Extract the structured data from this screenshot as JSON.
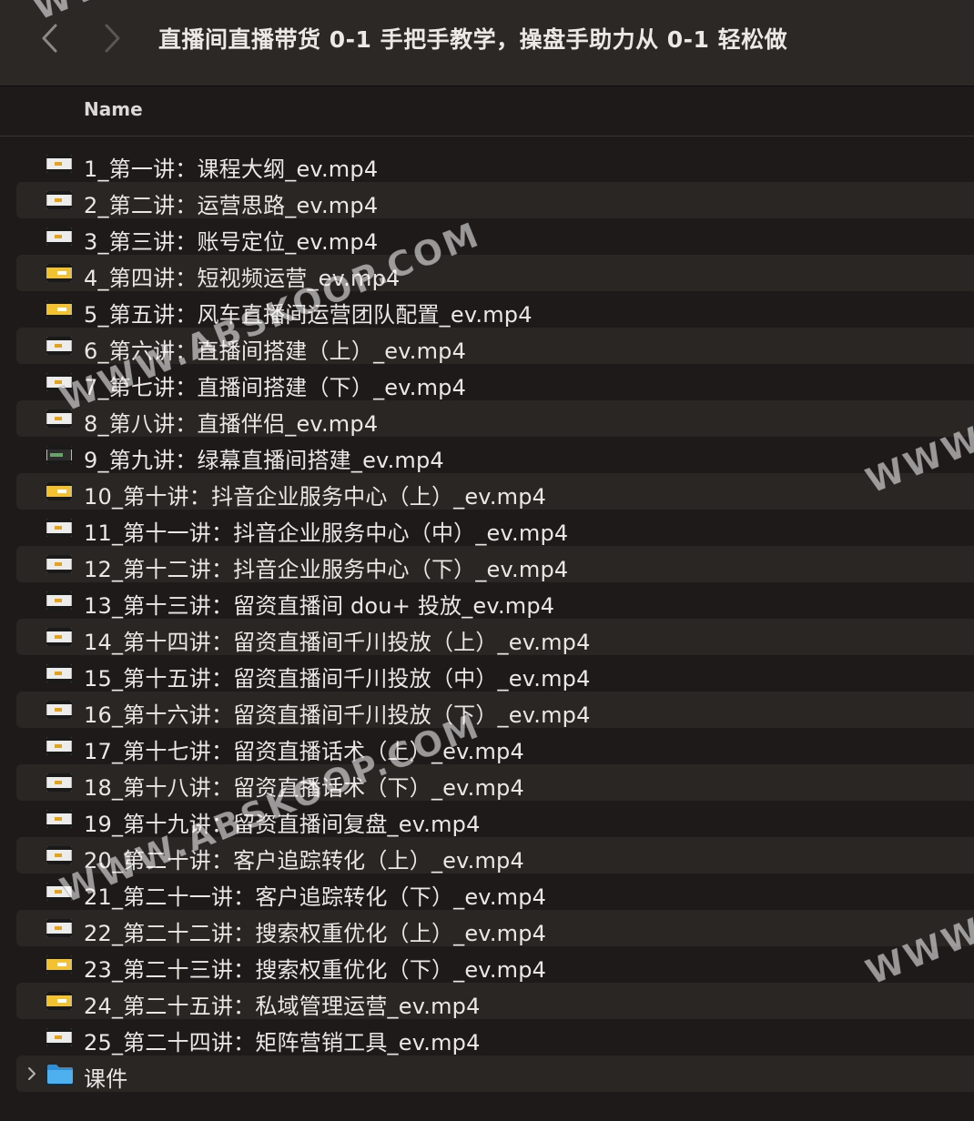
{
  "window": {
    "title": "直播间直播带货 0-1 手把手教学，操盘手助力从 0-1 轻松做"
  },
  "nav": {
    "back_icon": "chevron-left-icon",
    "forward_icon": "chevron-right-icon"
  },
  "columns": {
    "name": "Name"
  },
  "files": [
    {
      "name": "1_第一讲：课程大纲_ev.mp4",
      "thumb": "light"
    },
    {
      "name": "2_第二讲：运营思路_ev.mp4",
      "thumb": "light"
    },
    {
      "name": "3_第三讲：账号定位_ev.mp4",
      "thumb": "light"
    },
    {
      "name": "4_第四讲：短视频运营_ev.mp4",
      "thumb": "yellow"
    },
    {
      "name": "5_第五讲：风车直播间运营团队配置_ev.mp4",
      "thumb": "yellow"
    },
    {
      "name": "6_第六讲：直播间搭建（上）_ev.mp4",
      "thumb": "light"
    },
    {
      "name": "7_第七讲：直播间搭建（下）_ev.mp4",
      "thumb": "light"
    },
    {
      "name": "8_第八讲：直播伴侣_ev.mp4",
      "thumb": "light"
    },
    {
      "name": "9_第九讲：绿幕直播间搭建_ev.mp4",
      "thumb": "dark"
    },
    {
      "name": "10_第十讲：抖音企业服务中心（上）_ev.mp4",
      "thumb": "yellow"
    },
    {
      "name": "11_第十一讲：抖音企业服务中心（中）_ev.mp4",
      "thumb": "light"
    },
    {
      "name": "12_第十二讲：抖音企业服务中心（下）_ev.mp4",
      "thumb": "light"
    },
    {
      "name": "13_第十三讲：留资直播间 dou+ 投放_ev.mp4",
      "thumb": "light"
    },
    {
      "name": "14_第十四讲：留资直播间千川投放（上）_ev.mp4",
      "thumb": "light"
    },
    {
      "name": "15_第十五讲：留资直播间千川投放（中）_ev.mp4",
      "thumb": "light"
    },
    {
      "name": "16_第十六讲：留资直播间千川投放（下）_ev.mp4",
      "thumb": "light"
    },
    {
      "name": "17_第十七讲：留资直播话术（上）_ev.mp4",
      "thumb": "light"
    },
    {
      "name": "18_第十八讲：留资直播话术（下）_ev.mp4",
      "thumb": "light"
    },
    {
      "name": "19_第十九讲：留资直播间复盘_ev.mp4",
      "thumb": "light"
    },
    {
      "name": "20_第二十讲：客户追踪转化（上）_ev.mp4",
      "thumb": "light"
    },
    {
      "name": "21_第二十一讲：客户追踪转化（下）_ev.mp4",
      "thumb": "light"
    },
    {
      "name": "22_第二十二讲：搜索权重优化（上）_ev.mp4",
      "thumb": "light"
    },
    {
      "name": "23_第二十三讲：搜索权重优化（下）_ev.mp4",
      "thumb": "yellow"
    },
    {
      "name": "24_第二十五讲：私域管理运营_ev.mp4",
      "thumb": "yellow"
    },
    {
      "name": "25_第二十四讲：矩阵营销工具_ev.mp4",
      "thumb": "light"
    }
  ],
  "folder": {
    "name": "课件",
    "icon": "folder-icon",
    "disclosure_icon": "chevron-right-icon"
  },
  "watermarks": [
    "WWW.ABSKOOP.COM",
    "WWW",
    "WWW.ABSKOOP.COM",
    "WWW",
    "WWW"
  ],
  "colors": {
    "window_bg": "#1e1a19",
    "titlebar_bg": "#2c2826",
    "row_alt_bg": "#2a2624",
    "folder_blue": "#3ea3e8"
  }
}
